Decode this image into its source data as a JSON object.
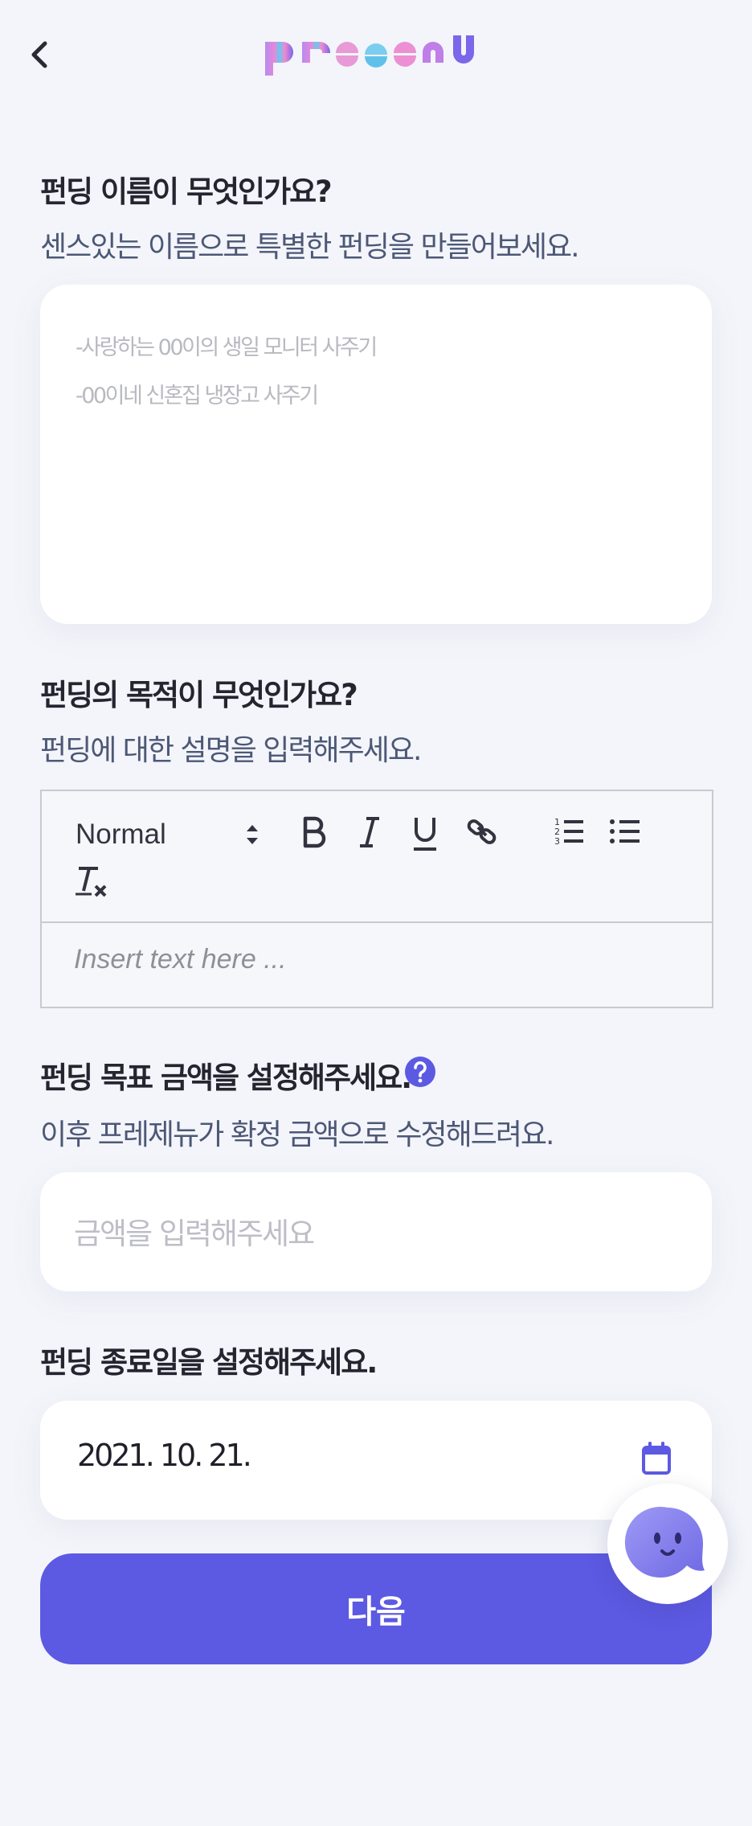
{
  "header": {
    "back_icon": "chevron-left-icon",
    "logo_text": "presenu"
  },
  "name_section": {
    "title": "펀딩 이름이 무엇인가요?",
    "subtitle": "센스있는 이름으로 특별한 펀딩을 만들어보세요.",
    "placeholder_lines": [
      "-사랑하는 00이의 생일 모니터 사주기",
      "-00이네 신혼집 냉장고 사주기"
    ]
  },
  "purpose_section": {
    "title": "펀딩의 목적이 무엇인가요?",
    "subtitle": "펀딩에 대한 설명을 입력해주세요.",
    "editor": {
      "format_value": "Normal",
      "toolbar_icons": [
        "bold-icon",
        "italic-icon",
        "underline-icon",
        "link-icon",
        "ordered-list-icon",
        "bullet-list-icon",
        "clear-format-icon"
      ],
      "placeholder": "Insert text here ..."
    }
  },
  "amount_section": {
    "title": "펀딩 목표 금액을 설정해주세요.",
    "help_icon": "question-circle-icon",
    "subtitle": "이후 프레제뉴가 확정 금액으로 수정해드려요.",
    "placeholder": "금액을 입력해주세요"
  },
  "date_section": {
    "title": "펀딩 종료일을 설정해주세요.",
    "value": "2021. 10. 21.",
    "calendar_icon": "calendar-icon"
  },
  "next_button": {
    "label": "다음"
  },
  "chat_button": {
    "icon": "chatbot-ghost-icon"
  },
  "colors": {
    "accent": "#5c59e3",
    "background": "#f3f5fa",
    "logo_gradient": [
      "#b07cf0",
      "#5fc6f0",
      "#f08ad0",
      "#6b62ea"
    ]
  }
}
